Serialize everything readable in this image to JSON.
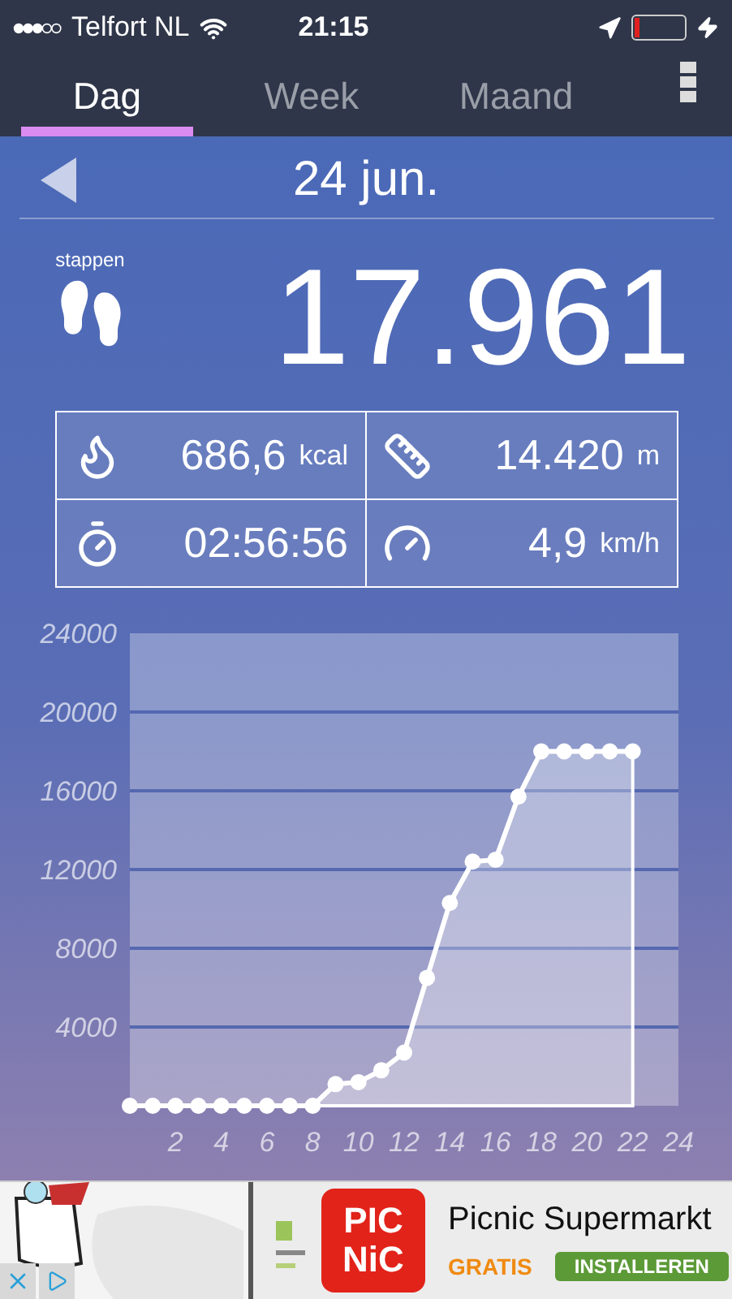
{
  "status_bar": {
    "carrier": "Telfort NL",
    "time": "21:15"
  },
  "tabs": [
    {
      "label": "Dag",
      "selected": true
    },
    {
      "label": "Week",
      "selected": false
    },
    {
      "label": "Maand",
      "selected": false
    }
  ],
  "date_nav": {
    "date": "24 jun."
  },
  "steps": {
    "label": "stappen",
    "value": "17.961"
  },
  "stats": [
    {
      "kind": "calories",
      "value": "686,6",
      "unit": "kcal"
    },
    {
      "kind": "distance",
      "value": "14.420",
      "unit": "m"
    },
    {
      "kind": "duration",
      "value": "02:56:56"
    },
    {
      "kind": "speed",
      "value": "4,9",
      "unit": "km/h"
    }
  ],
  "chart": {
    "chart_data": {
      "type": "area",
      "x": [
        0,
        1,
        2,
        3,
        4,
        5,
        6,
        7,
        8,
        9,
        10,
        11,
        12,
        13,
        14,
        15,
        16,
        17,
        18,
        19,
        20,
        21,
        22
      ],
      "series": [
        {
          "color": "#ffffff",
          "values": [
            0,
            0,
            0,
            0,
            0,
            0,
            0,
            0,
            0,
            1100,
            1200,
            1800,
            2700,
            6500,
            10300,
            12400,
            12500,
            15700,
            18000,
            18000,
            18000,
            18000,
            18000
          ]
        }
      ],
      "grid": true,
      "xlim": [
        0,
        24
      ],
      "ylim": [
        0,
        24000
      ],
      "xticks": [
        2,
        4,
        6,
        8,
        10,
        12,
        14,
        16,
        18,
        20,
        22,
        24
      ],
      "yticks": [
        4000,
        8000,
        12000,
        16000,
        20000,
        24000
      ]
    }
  },
  "ad": {
    "logo_lines": [
      "PIC",
      "NiC"
    ],
    "title": "Picnic Supermarkt",
    "price": "GRATIS",
    "button": "INSTALLEREN"
  }
}
